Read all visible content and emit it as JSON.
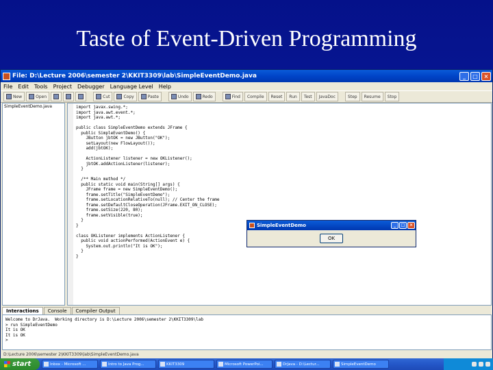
{
  "slide": {
    "title": "Taste of Event-Driven Programming"
  },
  "window": {
    "title": "File: D:\\Lecture 2006\\semester 2\\KKIT3309\\lab\\SimpleEventDemo.java",
    "controls": {
      "minimize": "_",
      "maximize": "□",
      "close": "×"
    }
  },
  "menu": [
    "File",
    "Edit",
    "Tools",
    "Project",
    "Debugger",
    "Language Level",
    "Help"
  ],
  "toolbar": [
    "New",
    "Open",
    "",
    "",
    "",
    "Cut",
    "Copy",
    "Paste",
    "Undo",
    "Redo",
    "Find",
    "Compile",
    "Reset",
    "Run",
    "Test",
    "JavaDoc",
    "Step",
    "Resume",
    "Stop"
  ],
  "files": {
    "selected": "SimpleEventDemo.java"
  },
  "code": "import javax.swing.*;\nimport java.awt.event.*;\nimport java.awt.*;\n\npublic class SimpleEventDemo extends JFrame {\n  public SimpleEventDemo() {\n    JButton jbtOK = new JButton(\"OK\");\n    setLayout(new FlowLayout());\n    add(jbtOK);\n\n    ActionListener listener = new OKListener();\n    jbtOK.addActionListener(listener);\n  }\n\n  /** Main method */\n  public static void main(String[] args) {\n    JFrame frame = new SimpleEventDemo();\n    frame.setTitle(\"SimpleEventDemo\");\n    frame.setLocationRelativeTo(null); // Center the frame\n    frame.setDefaultCloseOperation(JFrame.EXIT_ON_CLOSE);\n    frame.setSize(220, 80);\n    frame.setVisible(true);\n  }\n}\n\nclass OKListener implements ActionListener {\n  public void actionPerformed(ActionEvent e) {\n    System.out.println(\"It is OK\");\n  }\n}",
  "dialog": {
    "title": "SimpleEventDemo",
    "ok_label": "OK"
  },
  "tabs": [
    "Interactions",
    "Console",
    "Compiler Output"
  ],
  "console": "Welcome to DrJava.  Working directory is D:\\Lecture 2006\\semester 2\\KKIT3309\\lab\n> run SimpleEventDemo\nIt is OK\nIt is OK\n>",
  "status": "D:\\Lecture 2006\\semester 2\\KKIT3309\\lab\\SimpleEventDemo.java",
  "taskbar": {
    "start": "start",
    "items": [
      "Inbox - Microsoft ...",
      "Intro to Java Prog...",
      "KKIT3309",
      "Microsoft PowerPoi...",
      "DrJava - D:\\Lectur...",
      "SimpleEventDemo"
    ]
  }
}
